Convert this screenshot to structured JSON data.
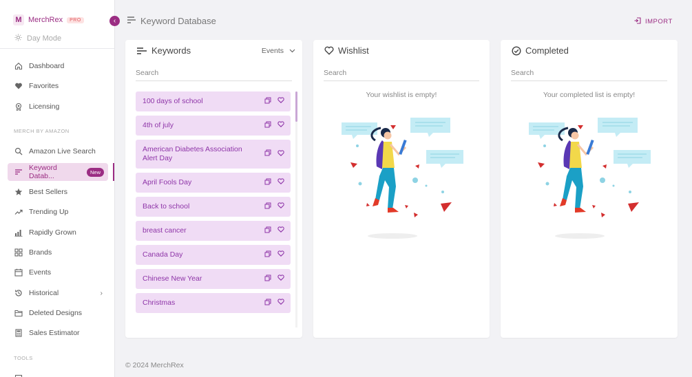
{
  "sidebar": {
    "brand": "MerchRex",
    "pro": "PRO",
    "day_mode": "Day Mode",
    "items": [
      {
        "label": "Dashboard"
      },
      {
        "label": "Favorites"
      },
      {
        "label": "Licensing"
      },
      {
        "label": "Amazon Live Search"
      },
      {
        "label": "Keyword Datab...",
        "badge": "New"
      },
      {
        "label": "Best Sellers"
      },
      {
        "label": "Trending Up"
      },
      {
        "label": "Rapidly Grown"
      },
      {
        "label": "Brands"
      },
      {
        "label": "Events"
      },
      {
        "label": "Historical"
      },
      {
        "label": "Deleted Designs"
      },
      {
        "label": "Sales Estimator"
      }
    ],
    "section_merch": "MERCH BY AMAZON",
    "section_tools": "TOOLS"
  },
  "header": {
    "title": "Keyword Database",
    "import": "IMPORT"
  },
  "keywords": {
    "title": "Keywords",
    "filter": "Events",
    "search_placeholder": "Search",
    "items": [
      "100 days of school",
      "4th of july",
      "American Diabetes Association Alert Day",
      "April Fools Day",
      "Back to school",
      "breast cancer",
      "Canada Day",
      "Chinese New Year",
      "Christmas"
    ]
  },
  "wishlist": {
    "title": "Wishlist",
    "search_placeholder": "Search",
    "empty": "Your wishlist is empty!"
  },
  "completed": {
    "title": "Completed",
    "search_placeholder": "Search",
    "empty": "Your completed list is empty!"
  },
  "footer": "© 2024 MerchRex",
  "colors": {
    "accent": "#9b2d83",
    "keyword_bg": "#f0dcf5",
    "keyword_text": "#8e35a8"
  }
}
